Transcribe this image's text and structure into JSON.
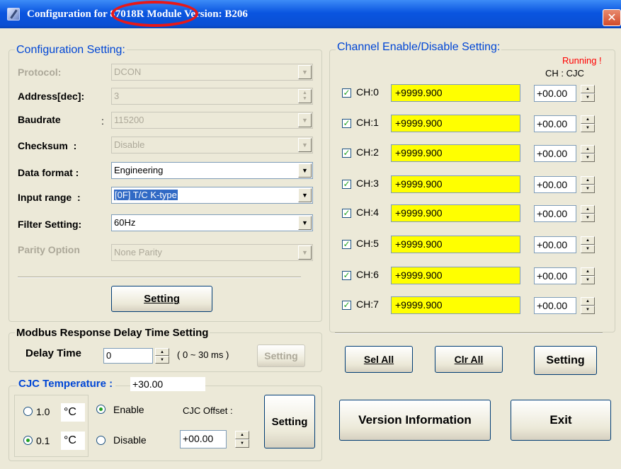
{
  "window": {
    "title_prefix": "Configuration fo",
    "title_module": "r 87018R",
    "title_suffix": "Module Version: B206",
    "close_glyph": "✕"
  },
  "config": {
    "legend": "Configuration Setting:",
    "protocol": {
      "label": "Protocol:",
      "value": "DCON"
    },
    "address": {
      "label": "Address[dec]:",
      "value": "3"
    },
    "baudrate": {
      "label": "Baudrate",
      "colon": ":",
      "value": "115200"
    },
    "checksum": {
      "label": "Checksum  :",
      "value": "Disable"
    },
    "data_format": {
      "label": "Data format :",
      "value": "Engineering"
    },
    "input_range": {
      "label": "Input range  :",
      "value": "[0F] T/C K-type"
    },
    "filter": {
      "label": "Filter Setting:",
      "value": "60Hz"
    },
    "parity": {
      "label": "Parity Option",
      "value": "None Parity"
    },
    "setting_button": "Setting"
  },
  "modbus": {
    "legend": "Modbus Response Delay Time Setting",
    "delay_label": "Delay Time",
    "delay_value": "0",
    "range": "( 0 ~ 30 ms )",
    "setting_button": "Setting"
  },
  "cjc": {
    "legend": "CJC Temperature :",
    "temperature": "+30.00",
    "res_10": "1.0",
    "res_01": "0.1",
    "unit": "°C",
    "enable": "Enable",
    "disable": "Disable",
    "offset_label": "CJC Offset :",
    "offset_value": "+00.00",
    "setting_button": "Setting"
  },
  "channels": {
    "legend": "Channel Enable/Disable Setting:",
    "status": "Running !",
    "cjc_header": "CH : CJC",
    "items": [
      {
        "label": "CH:0",
        "value": "+9999.900",
        "cjc": "+00.00"
      },
      {
        "label": "CH:1",
        "value": "+9999.900",
        "cjc": "+00.00"
      },
      {
        "label": "CH:2",
        "value": "+9999.900",
        "cjc": "+00.00"
      },
      {
        "label": "CH:3",
        "value": "+9999.900",
        "cjc": "+00.00"
      },
      {
        "label": "CH:4",
        "value": "+9999.900",
        "cjc": "+00.00"
      },
      {
        "label": "CH:5",
        "value": "+9999.900",
        "cjc": "+00.00"
      },
      {
        "label": "CH:6",
        "value": "+9999.900",
        "cjc": "+00.00"
      },
      {
        "label": "CH:7",
        "value": "+9999.900",
        "cjc": "+00.00"
      }
    ],
    "check_glyph": "✓",
    "sel_all": "Sel All",
    "clr_all": "Clr All",
    "setting_button": "Setting"
  },
  "footer": {
    "version_button": "Version Information",
    "exit_button": "Exit"
  },
  "colors": {
    "title_blue": "#0a55e0",
    "legend_blue": "#0046d5",
    "channel_value_bg": "#ffff00",
    "status_red": "#ff0000",
    "highlight_red": "#e81818"
  }
}
